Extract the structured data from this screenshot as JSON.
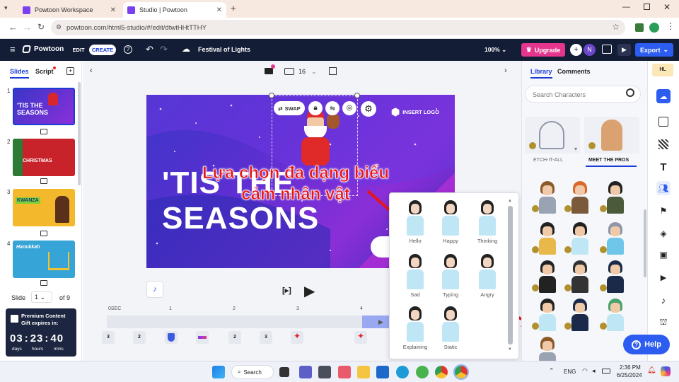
{
  "browser": {
    "tabs": [
      {
        "title": "Powtoon Workspace"
      },
      {
        "title": "Studio | Powtoon"
      }
    ],
    "url": "powtoon.com/html5-studio/#/edit/dtwtHHtTTHY"
  },
  "header": {
    "logo": "Powtoon",
    "edit": "EDIT",
    "create": "CREATE",
    "project_title": "Festival of Lights",
    "zoom": "100%",
    "upgrade": "Upgrade",
    "avatar": "N",
    "export": "Export"
  },
  "slides_panel": {
    "tab_slides": "Slides",
    "tab_script": "Script",
    "slides": [
      {
        "num": "1",
        "text": "'TIS THE SEASONS"
      },
      {
        "num": "2",
        "text": "CHRISTMAS"
      },
      {
        "num": "3",
        "text": "KWANZA"
      },
      {
        "num": "4",
        "text": "Hanukkah"
      }
    ],
    "slide_label": "Slide",
    "slide_value": "1",
    "slide_of": "of 9"
  },
  "promo": {
    "title": "Premium Content Gift expires in:",
    "days": "03",
    "hours": "23",
    "mins": "40",
    "days_lbl": "days",
    "hours_lbl": "hours",
    "mins_lbl": "mins"
  },
  "toolbar": {
    "font_size": "16"
  },
  "stage": {
    "swap": "SWAP",
    "insert_logo": "INSERT LOGO",
    "title_line1": "'TIS THE",
    "title_line2": "SEASONS"
  },
  "timeline": {
    "labels": [
      "0SEC",
      "1",
      "2",
      "3",
      "4"
    ],
    "items": [
      "3",
      "2",
      "",
      "",
      "2",
      "3",
      "",
      ""
    ]
  },
  "expressions": [
    {
      "label": "Hello"
    },
    {
      "label": "Happy"
    },
    {
      "label": "Thinking"
    },
    {
      "label": "Sad"
    },
    {
      "label": "Typing"
    },
    {
      "label": "Angry"
    },
    {
      "label": "Explaining"
    },
    {
      "label": "Static"
    }
  ],
  "library": {
    "tab_library": "Library",
    "tab_comments": "Comments",
    "search_placeholder": "Search Characters",
    "cat1": "ETCH-IT-ALL",
    "cat2": "MEET THE PROS"
  },
  "help": "Help",
  "annotation": {
    "line1": "Lựa chọn đa dạng biểu",
    "line2": "cảm nhân vật"
  },
  "taskbar": {
    "search": "Search",
    "lang": "ENG",
    "time": "2:36 PM",
    "date": "6/25/2024"
  }
}
